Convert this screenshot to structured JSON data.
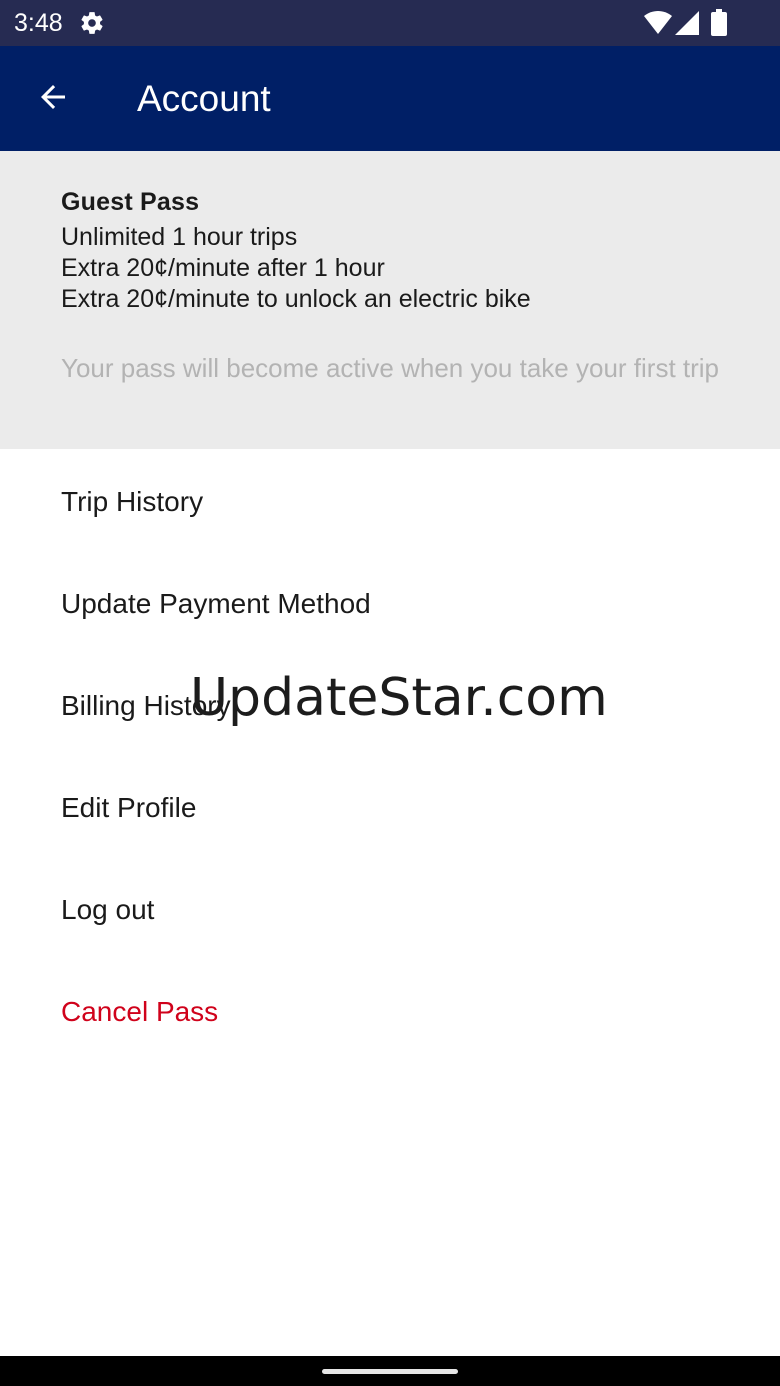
{
  "status_bar": {
    "time": "3:48",
    "icons": [
      "gear-icon",
      "wifi-icon",
      "signal-icon",
      "battery-icon"
    ]
  },
  "app_bar": {
    "back_icon": "arrow-left-icon",
    "title": "Account"
  },
  "pass_card": {
    "name": "Guest Pass",
    "features": [
      "Unlimited 1 hour trips",
      "Extra 20¢/minute after 1 hour",
      "Extra 20¢/minute to unlock an electric bike"
    ],
    "note": "Your pass will become active when you take your first trip"
  },
  "menu": {
    "items": [
      {
        "label": "Trip History"
      },
      {
        "label": "Update Payment Method"
      },
      {
        "label": "Billing History"
      },
      {
        "label": "Edit Profile"
      },
      {
        "label": "Log out"
      },
      {
        "label": "Cancel Pass"
      }
    ]
  },
  "watermark": {
    "text": "UpdateStar.com"
  },
  "colors": {
    "status_bar": "#262b52",
    "app_bar": "#001f66",
    "card_background": "#ebebeb",
    "danger": "#d0021b",
    "note_text": "#b3b3b3"
  }
}
